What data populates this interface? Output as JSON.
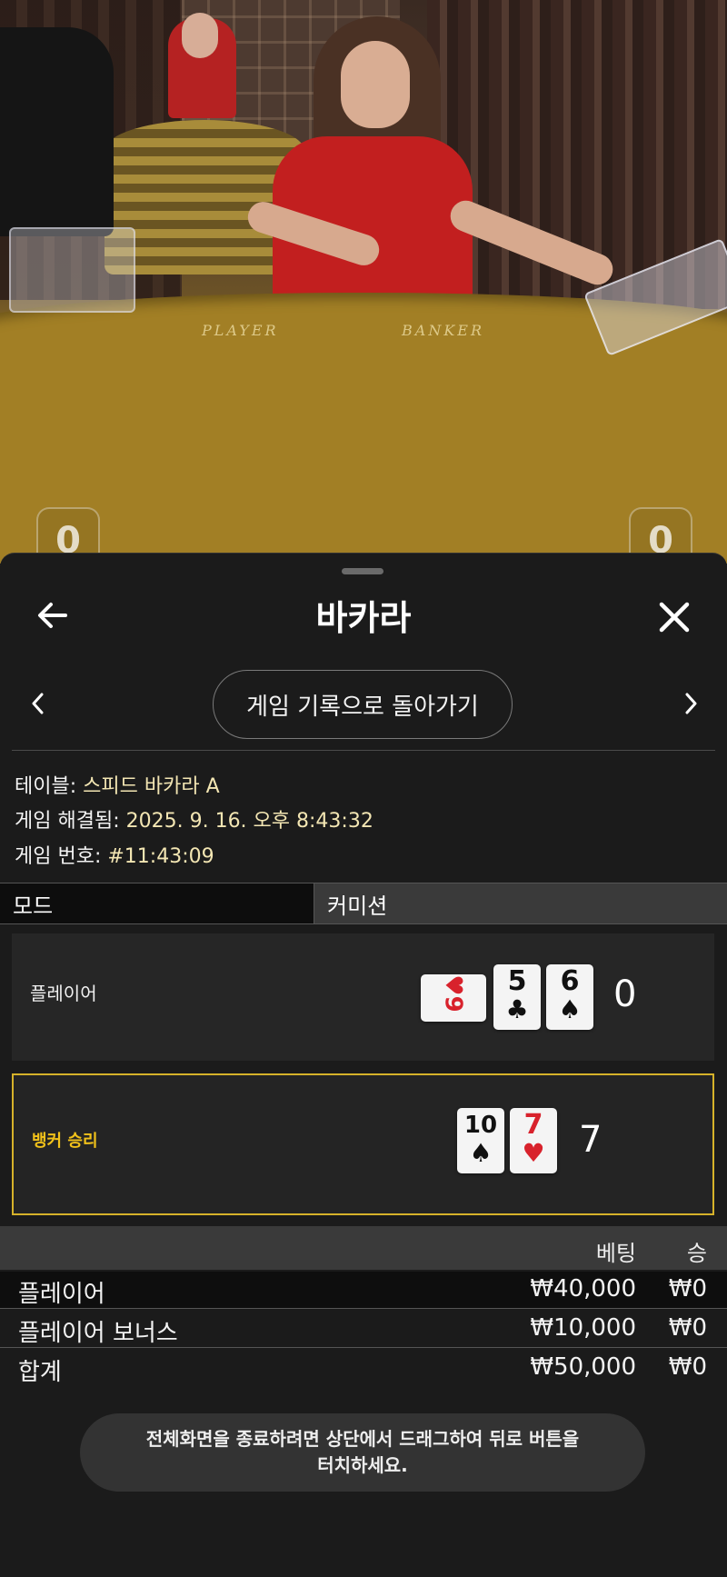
{
  "video": {
    "felt_player": "PLAYER",
    "felt_banker": "BANKER",
    "score_left": "0",
    "score_right": "0"
  },
  "header": {
    "title": "바카라",
    "back_icon": "arrow-left-icon",
    "close_icon": "close-icon"
  },
  "nav": {
    "return_label": "게임 기록으로 돌아가기",
    "prev_icon": "chevron-left-icon",
    "next_icon": "chevron-right-icon"
  },
  "info": {
    "table_label": "테이블:",
    "table_value": "스피드 바카라 A",
    "resolved_label": "게임 해결됨:",
    "resolved_value": "2025. 9. 16. 오후 8:43:32",
    "number_label": "게임 번호:",
    "number_value": "#11:43:09"
  },
  "mode": {
    "label": "모드",
    "value": "커미션"
  },
  "hands": {
    "player": {
      "label": "플레이어",
      "score": "0",
      "cards": [
        {
          "rank": "9",
          "suit": "♥",
          "color": "red",
          "sideways": true
        },
        {
          "rank": "5",
          "suit": "♣",
          "color": "black"
        },
        {
          "rank": "6",
          "suit": "♠",
          "color": "black"
        }
      ]
    },
    "banker": {
      "label": "뱅커 승리",
      "score": "7",
      "cards": [
        {
          "rank": "10",
          "suit": "♠",
          "color": "black"
        },
        {
          "rank": "7",
          "suit": "♥",
          "color": "red"
        }
      ]
    }
  },
  "bets": {
    "headers": {
      "bet": "베팅",
      "win": "승"
    },
    "rows": [
      {
        "name": "플레이어",
        "amount": "₩40,000",
        "win": "₩0"
      },
      {
        "name": "플레이어 보너스",
        "amount": "₩10,000",
        "win": "₩0"
      },
      {
        "name": "합계",
        "amount": "₩50,000",
        "win": "₩0"
      }
    ]
  },
  "toast": {
    "message": "전체화면을 종료하려면 상단에서 드래그하여 뒤로 버튼을 터치하세요."
  },
  "colors": {
    "accent_gold": "#d6b22a",
    "banker_win_text": "#f2c21a",
    "info_value": "#f3e6b3",
    "card_red": "#d8222c"
  }
}
